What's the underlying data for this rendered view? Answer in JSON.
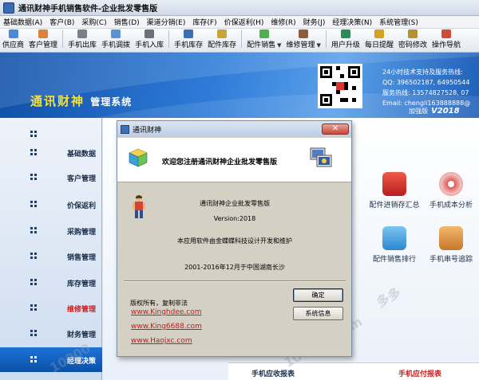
{
  "window": {
    "title": "通讯财神手机销售软件-企业批发零售版"
  },
  "menu": [
    "基础数据(A)",
    "客户(B)",
    "采购(C)",
    "销售(D)",
    "渠道分销(E)",
    "库存(F)",
    "价保返利(H)",
    "维修(R)",
    "财务(J)",
    "经理决策(N)",
    "系统管理(S)"
  ],
  "toolbar": [
    "供应商",
    "客户管理",
    "手机出库",
    "手机调拨",
    "手机入库",
    "手机库存",
    "配件库存",
    "配件销售",
    "维修管理",
    "用户升级",
    "每日提醒",
    "密码修改",
    "操作导航"
  ],
  "banner": {
    "title_main": "通讯财神",
    "title_sub": "管理系统",
    "contact_line1": "24小时技术支持及服务热线:",
    "contact_line2": "QQ: 396502187, 64950544",
    "contact_line3": "服务热线: 13574827528, 07",
    "contact_line4": "Email: chengli163888888@",
    "edition": "加强版",
    "version": "V2018"
  },
  "sidebar": [
    "基础数据",
    "客户管理",
    "价保返利",
    "采购管理",
    "销售管理",
    "库存管理",
    "维修管理",
    "财务管理",
    "经理决策"
  ],
  "tiles": [
    "配件进销存汇总",
    "手机成本分析",
    "配件销售排行",
    "手机串号追踪"
  ],
  "bottom_panel": {
    "left": "手机应收报表",
    "right": "手机应付报表"
  },
  "dialog": {
    "title": "通讯财神",
    "close": "✕",
    "welcome": "欢迎您注册通讯财神企业批发零售版",
    "product": "通讯财神企业批发零售版",
    "version": "Version:2018",
    "developer": "本应用软件由金蝶蝶科技设计开发和维护",
    "copyright_year": "2001-2016年12月于中国湖南长沙",
    "rights": "版权所有，复制非法",
    "links": [
      "www.Kinghdee.com",
      "www.King6688.com",
      "www.Haojxc.com"
    ],
    "ok_button": "确定",
    "sysinfo_button": "系统信息"
  }
}
